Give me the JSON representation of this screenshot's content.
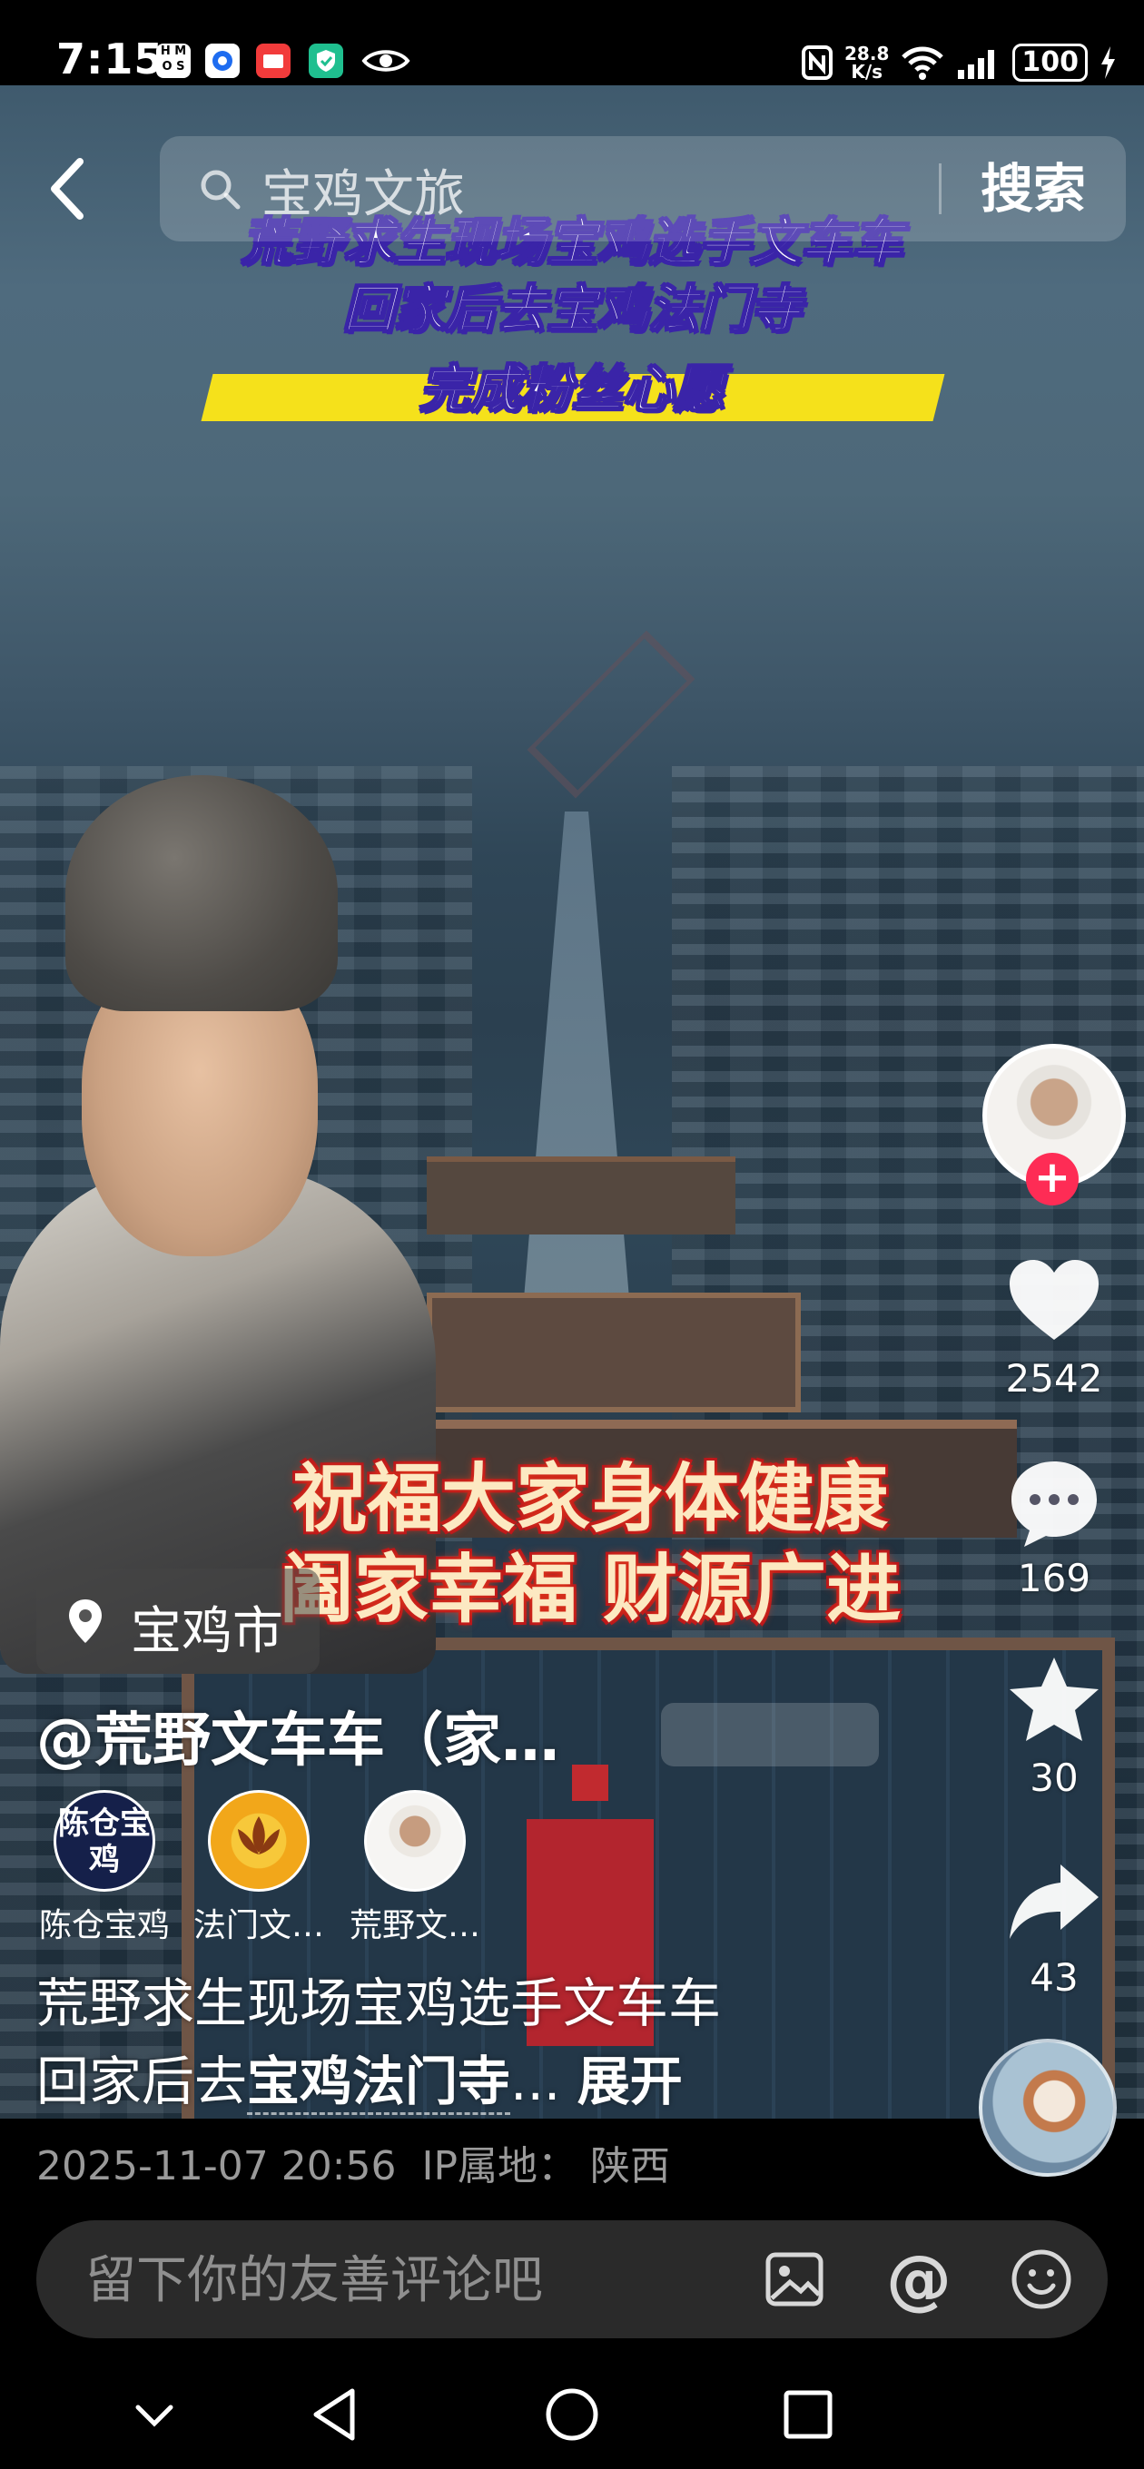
{
  "status_bar": {
    "time": "7:15",
    "net_speed_value": "28.8",
    "net_speed_unit": "K/s",
    "battery": "100",
    "signal": "6"
  },
  "search": {
    "query": "宝鸡文旅",
    "button_label": "搜索"
  },
  "video_overlay": {
    "headline_1": "荒野求生现场宝鸡选手文车车",
    "headline_2": "回家后去宝鸡法门寺",
    "headline_3": "完成粉丝心愿",
    "blessing_1": "祝福大家身体健康",
    "blessing_2": "阖家幸福 财源广进"
  },
  "actions": {
    "likes": "2542",
    "comments": "169",
    "favorites": "30",
    "shares": "43"
  },
  "location": "宝鸡市",
  "author": {
    "name": "@荒野文车车（家…"
  },
  "related_accounts": [
    {
      "name": "陈仓宝鸡",
      "avatar_text": "陈仓宝鸡"
    },
    {
      "name": "法门文…"
    },
    {
      "name": "荒野文…"
    }
  ],
  "description": {
    "line1": "荒野求生现场宝鸡选手文车车",
    "line2_prefix": "回家后去",
    "link": "宝鸡法门寺",
    "ellipsis": "...",
    "expand": "展开"
  },
  "meta": {
    "datetime": "2025-11-07 20:56",
    "ip_label": "IP属地：",
    "ip_location": "陕西"
  },
  "comment": {
    "placeholder": "留下你的友善评论吧",
    "at_symbol": "@"
  },
  "colors": {
    "follow_accent": "#fe2c55",
    "headline_stroke": "#3a24a8",
    "highlight_band": "#f5e11b",
    "blessing_text": "#fce9c2",
    "blessing_glow": "#b5121b"
  }
}
